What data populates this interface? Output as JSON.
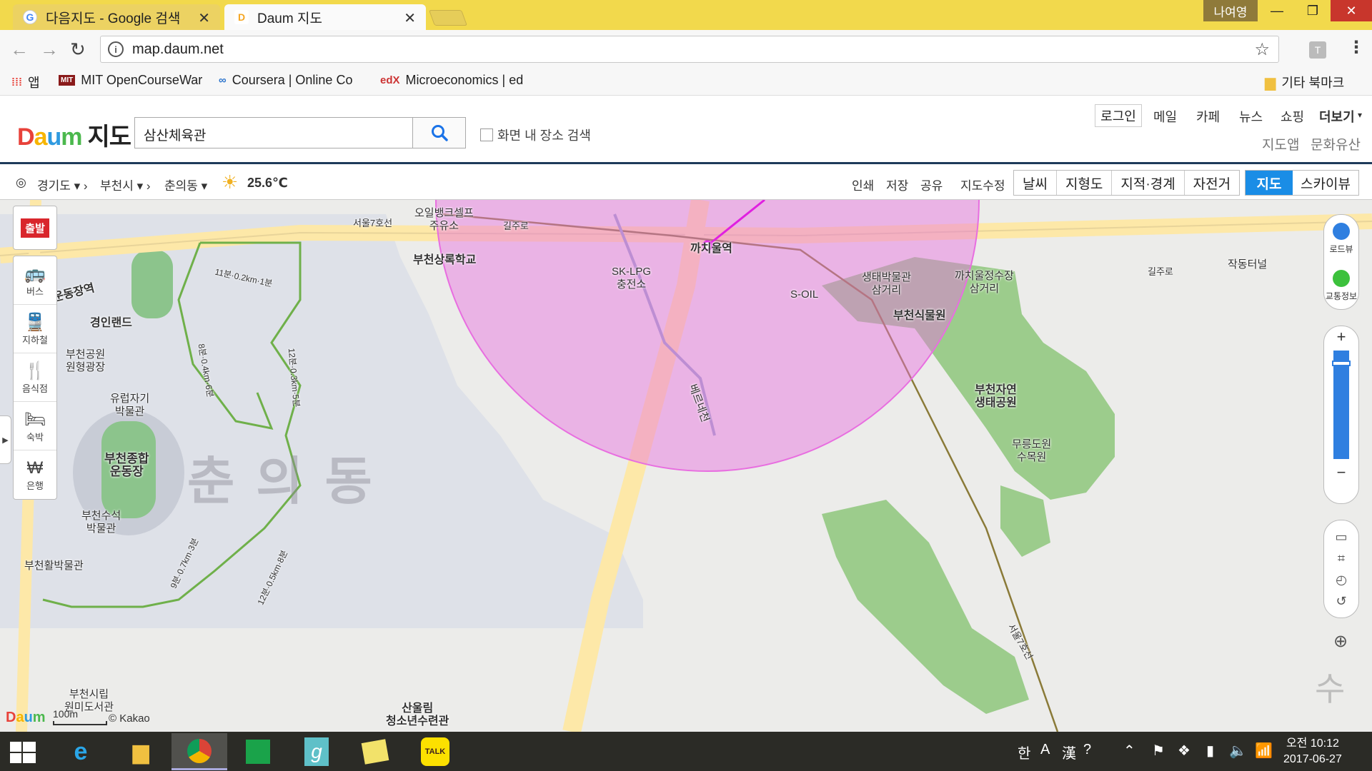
{
  "browser": {
    "tabs": [
      {
        "title": "다음지도 - Google 검색",
        "favicon": "google-icon"
      },
      {
        "title": "Daum 지도",
        "favicon": "daum-icon"
      }
    ],
    "profile_name": "나여영",
    "url": "map.daum.net",
    "extension_label": "T",
    "bookmarks": [
      {
        "label": "앱"
      },
      {
        "label": "MIT OpenCourseWar"
      },
      {
        "label": "Coursera | Online Co"
      },
      {
        "label": "Microeconomics | ed"
      }
    ],
    "other_bookmarks": "기타 북마크"
  },
  "daum": {
    "logo_brand": "Daum",
    "logo_text": "지도",
    "search_value": "삼산체육관",
    "area_search_label": "화면 내 장소 검색",
    "login": "로그인",
    "top_links": [
      "메일",
      "카페",
      "뉴스",
      "쇼핑",
      "더보기"
    ],
    "sub_links": [
      "지도앱",
      "문화유산"
    ]
  },
  "maptool": {
    "breadcrumbs": [
      "경기도",
      "부천시",
      "춘의동"
    ],
    "temperature": "25.6℃",
    "actions": [
      "인쇄",
      "저장",
      "공유",
      "지도수정"
    ],
    "layers": [
      "날씨",
      "지형도",
      "지적·경계",
      "자전거"
    ],
    "views": {
      "map": "지도",
      "sky": "스카이뷰"
    }
  },
  "map": {
    "district": "춘의동",
    "labels": {
      "oil1": "오일뱅크셀프\n주유소",
      "school": "부천상록학교",
      "lpg": "SK-LPG\n충전소",
      "soil": "S-OIL",
      "station": "까치울역",
      "eco_museum": "생태박물관\n삼거리",
      "kkachi_jct": "까치울정수장\n삼거리",
      "tunnel": "작동터널",
      "botanical": "부천식물원",
      "eco_park": "부천자연\n생태공원",
      "arboretum": "무릉도원\n수목원",
      "stream": "베르네천",
      "line7": "서울7호선",
      "road": "길주로",
      "land": "경인랜드",
      "park_plaza": "부천공원\n원형광장",
      "ceramic": "유럽자기\n박물관",
      "stadium": "부천종합\n운동장",
      "water_museum": "부천수석\n박물관",
      "museum_active": "부천활박물관",
      "library": "부천시립\n원미도서관",
      "youth": "산울림\n청소년수련관",
      "sports_station": "운동장역",
      "trail1": "11분·0.2km·1분",
      "trail2": "8분·0.4km·6분",
      "trail3": "12분·0.3km·5분",
      "trail4": "9분·0.7km·3분",
      "trail5": "12분·0.5km·8분",
      "sun": "수"
    },
    "categories": [
      "출발",
      "버스",
      "지하철",
      "음식점",
      "숙박",
      "은행"
    ],
    "right_controls": [
      "로드뷰",
      "교통정보"
    ],
    "scale": "100m",
    "copyright": "© Kakao",
    "colors": {
      "radius_circle": "#e86ee0",
      "route": "#e020e0",
      "green": "#9ccc8c",
      "road": "#fde8a8"
    }
  },
  "taskbar": {
    "ime": [
      "한",
      "A",
      "漢"
    ],
    "clock_time": "오전 10:12",
    "clock_date": "2017-06-27",
    "talk_label": "TALK"
  }
}
